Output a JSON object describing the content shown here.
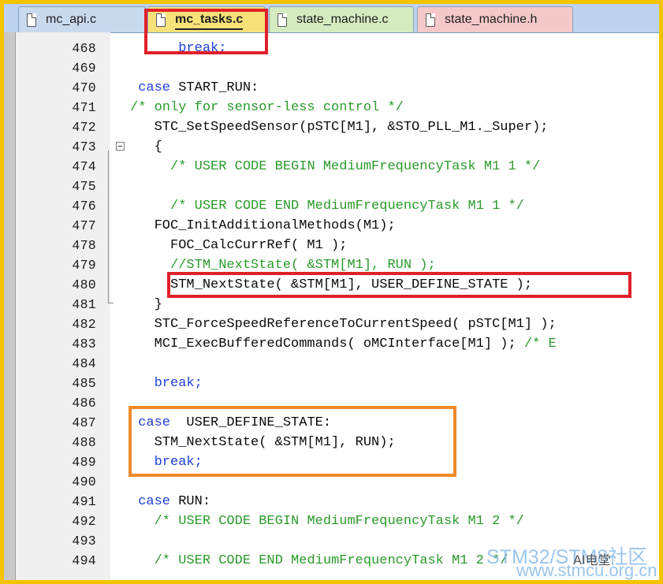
{
  "tabs": [
    {
      "label": "mc_api.c",
      "color": "#c9d9ee"
    },
    {
      "label": "mc_tasks.c",
      "color": "#f7e27a",
      "active": true
    },
    {
      "label": "state_machine.c",
      "color": "#d4ebc0"
    },
    {
      "label": "state_machine.h",
      "color": "#f5c9c9"
    }
  ],
  "lines": [
    {
      "n": "468",
      "tokens": [
        {
          "t": "      "
        },
        {
          "t": "break;",
          "c": "kw"
        }
      ]
    },
    {
      "n": "469",
      "tokens": []
    },
    {
      "n": "470",
      "tokens": [
        {
          "t": " "
        },
        {
          "t": "case",
          "c": "kw"
        },
        {
          "t": " START_RUN:"
        }
      ]
    },
    {
      "n": "471",
      "tokens": [
        {
          "t": "/* only for sensor-less control */",
          "c": "cm"
        }
      ]
    },
    {
      "n": "472",
      "tokens": [
        {
          "t": "   STC_SetSpeedSensor(pSTC[M1], &STO_PLL_M1._Super);"
        }
      ]
    },
    {
      "n": "473",
      "tokens": [
        {
          "t": "   {"
        }
      ],
      "fold": "start"
    },
    {
      "n": "474",
      "tokens": [
        {
          "t": "     "
        },
        {
          "t": "/* USER CODE BEGIN MediumFrequencyTask M1 1 */",
          "c": "cm"
        }
      ]
    },
    {
      "n": "475",
      "tokens": []
    },
    {
      "n": "476",
      "tokens": [
        {
          "t": "     "
        },
        {
          "t": "/* USER CODE END MediumFrequencyTask M1 1 */",
          "c": "cm"
        }
      ]
    },
    {
      "n": "477",
      "tokens": [
        {
          "t": "   FOC_InitAdditionalMethods(M1);"
        }
      ]
    },
    {
      "n": "478",
      "tokens": [
        {
          "t": "     FOC_CalcCurrRef( M1 );"
        }
      ]
    },
    {
      "n": "479",
      "tokens": [
        {
          "t": "     "
        },
        {
          "t": "//STM_NextState( &STM[M1], RUN );",
          "c": "cm"
        }
      ]
    },
    {
      "n": "480",
      "tokens": [
        {
          "t": "     STM_NextState( &STM[M1], USER_DEFINE_STATE );"
        }
      ]
    },
    {
      "n": "481",
      "tokens": [
        {
          "t": "   }"
        }
      ],
      "fold": "end"
    },
    {
      "n": "482",
      "tokens": [
        {
          "t": "   STC_ForceSpeedReferenceToCurrentSpeed( pSTC[M1] );"
        }
      ]
    },
    {
      "n": "483",
      "tokens": [
        {
          "t": "   MCI_ExecBufferedCommands( oMCInterface[M1] ); "
        },
        {
          "t": "/* E",
          "c": "cm"
        }
      ]
    },
    {
      "n": "484",
      "tokens": []
    },
    {
      "n": "485",
      "tokens": [
        {
          "t": "   "
        },
        {
          "t": "break;",
          "c": "kw"
        }
      ]
    },
    {
      "n": "486",
      "tokens": []
    },
    {
      "n": "487",
      "tokens": [
        {
          "t": " "
        },
        {
          "t": "case",
          "c": "kw"
        },
        {
          "t": "  USER_DEFINE_STATE:"
        }
      ]
    },
    {
      "n": "488",
      "tokens": [
        {
          "t": "   STM_NextState( &STM[M1], RUN);"
        }
      ]
    },
    {
      "n": "489",
      "tokens": [
        {
          "t": "   "
        },
        {
          "t": "break;",
          "c": "kw"
        }
      ]
    },
    {
      "n": "490",
      "tokens": []
    },
    {
      "n": "491",
      "tokens": [
        {
          "t": " "
        },
        {
          "t": "case",
          "c": "kw"
        },
        {
          "t": " RUN:"
        }
      ]
    },
    {
      "n": "492",
      "tokens": [
        {
          "t": "   "
        },
        {
          "t": "/* USER CODE BEGIN MediumFrequencyTask M1 2 */",
          "c": "cm"
        }
      ]
    },
    {
      "n": "493",
      "tokens": []
    },
    {
      "n": "494",
      "tokens": [
        {
          "t": "   "
        },
        {
          "t": "/* USER CODE END MediumFrequencyTask M1 2 */",
          "c": "cm"
        }
      ]
    }
  ],
  "watermark": {
    "line1": "STM32/STM8社区",
    "line2": "www.stmcu.org.cn",
    "badge": "AI电堂"
  }
}
